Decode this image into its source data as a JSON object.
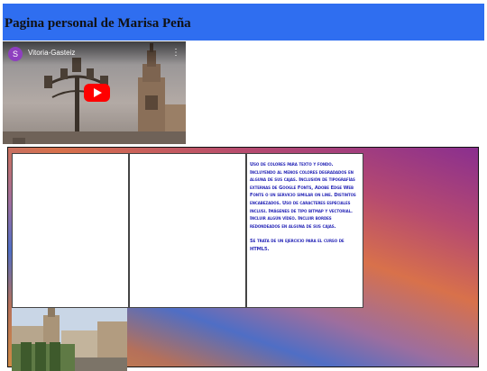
{
  "page": {
    "title": "Pagina personal de Marisa Peña"
  },
  "video": {
    "channel_initial": "S",
    "title": "Vitoria-Gasteiz",
    "menu_icon": "more-vert-icon",
    "play_icon": "youtube-play-icon"
  },
  "content": {
    "paragraph_1": "Uso de colores para texto y fondo. Incluyendo al menos colores degradados en alguna de sus cajas. Inclusión de tipografías externas de Google Fonts, Adobe Edge Web Fonts o un servicio similar on line. Distintos encabezados. Uso de caracteres especiales inclusi. Imágenes de tipo bitmap y vectorial. Incluir algún vídeo. Incluir bordes redondeados en alguna de sus cajas.",
    "paragraph_2": "Se trata de un ejercicio para el curso de HTML5."
  },
  "colors": {
    "header_bg": "#2f6ef0",
    "text_blue": "#2a2ab8",
    "youtube_red": "#ff0000"
  }
}
